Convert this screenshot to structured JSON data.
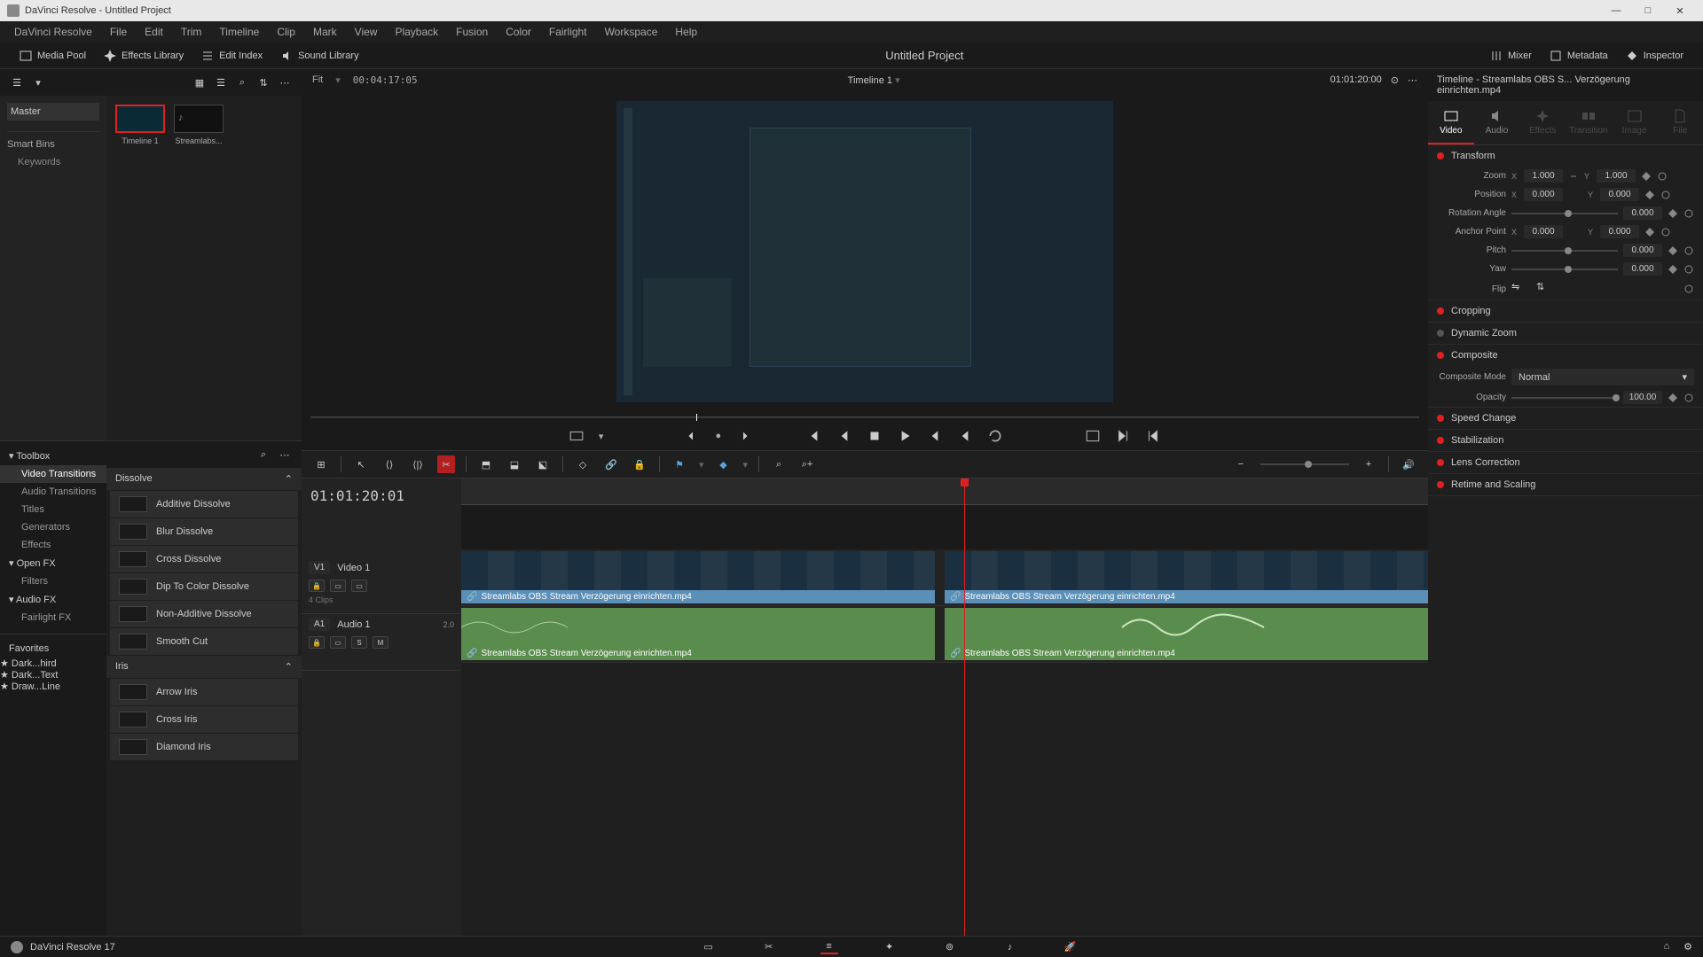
{
  "titlebar": {
    "title": "DaVinci Resolve - Untitled Project"
  },
  "menubar": [
    "DaVinci Resolve",
    "File",
    "Edit",
    "Trim",
    "Timeline",
    "Clip",
    "Mark",
    "View",
    "Playback",
    "Fusion",
    "Color",
    "Fairlight",
    "Workspace",
    "Help"
  ],
  "toolbar": {
    "media_pool": "Media Pool",
    "effects_library": "Effects Library",
    "edit_index": "Edit Index",
    "sound_library": "Sound Library",
    "project_title": "Untitled Project",
    "mixer": "Mixer",
    "metadata": "Metadata",
    "inspector": "Inspector"
  },
  "media_pool": {
    "master": "Master",
    "clips": [
      {
        "name": "Timeline 1",
        "selected": true,
        "type": "timeline"
      },
      {
        "name": "Streamlabs...",
        "selected": false,
        "type": "audio"
      }
    ],
    "smart_bins": "Smart Bins",
    "keywords": "Keywords"
  },
  "fx": {
    "tree": [
      {
        "label": "Toolbox",
        "expanded": true
      },
      {
        "label": "Video Transitions",
        "child": true,
        "selected": true
      },
      {
        "label": "Audio Transitions",
        "child": true
      },
      {
        "label": "Titles",
        "child": true
      },
      {
        "label": "Generators",
        "child": true
      },
      {
        "label": "Effects",
        "child": true
      },
      {
        "label": "Open FX",
        "expanded": true
      },
      {
        "label": "Filters",
        "child": true
      },
      {
        "label": "Audio FX",
        "expanded": true
      },
      {
        "label": "Fairlight FX",
        "child": true
      }
    ],
    "groups": [
      {
        "name": "Dissolve",
        "items": [
          "Additive Dissolve",
          "Blur Dissolve",
          "Cross Dissolve",
          "Dip To Color Dissolve",
          "Non-Additive Dissolve",
          "Smooth Cut"
        ]
      },
      {
        "name": "Iris",
        "items": [
          "Arrow Iris",
          "Cross Iris",
          "Diamond Iris"
        ]
      }
    ],
    "favorites": "Favorites",
    "fav_items": [
      "Dark...hird",
      "Dark...Text",
      "Draw...Line"
    ]
  },
  "viewer": {
    "fit": "Fit",
    "src_tc": "00:04:17:05",
    "name": "Timeline 1",
    "rec_tc": "01:01:20:00"
  },
  "timeline": {
    "tc": "01:01:20:01",
    "v1": {
      "badge": "V1",
      "name": "Video 1",
      "clips_info": "4 Clips"
    },
    "a1": {
      "badge": "A1",
      "name": "Audio 1",
      "ch": "2.0"
    },
    "clip_name": "Streamlabs OBS Stream Verzögerung einrichten.mp4"
  },
  "inspector": {
    "title": "Timeline - Streamlabs OBS S... Verzögerung einrichten.mp4",
    "tabs": [
      "Video",
      "Audio",
      "Effects",
      "Transition",
      "Image",
      "File"
    ],
    "transform": {
      "label": "Transform",
      "zoom": "Zoom",
      "zoom_x": "1.000",
      "zoom_y": "1.000",
      "position": "Position",
      "pos_x": "0.000",
      "pos_y": "0.000",
      "rotation": "Rotation Angle",
      "rot_val": "0.000",
      "anchor": "Anchor Point",
      "anc_x": "0.000",
      "anc_y": "0.000",
      "pitch": "Pitch",
      "pitch_val": "0.000",
      "yaw": "Yaw",
      "yaw_val": "0.000",
      "flip": "Flip"
    },
    "cropping": "Cropping",
    "dynamic_zoom": "Dynamic Zoom",
    "composite": {
      "label": "Composite",
      "mode_lbl": "Composite Mode",
      "mode": "Normal",
      "opacity_lbl": "Opacity",
      "opacity": "100.00"
    },
    "speed": "Speed Change",
    "stabilization": "Stabilization",
    "lens": "Lens Correction",
    "retime": "Retime and Scaling"
  },
  "bottombar": {
    "app": "DaVinci Resolve 17"
  }
}
